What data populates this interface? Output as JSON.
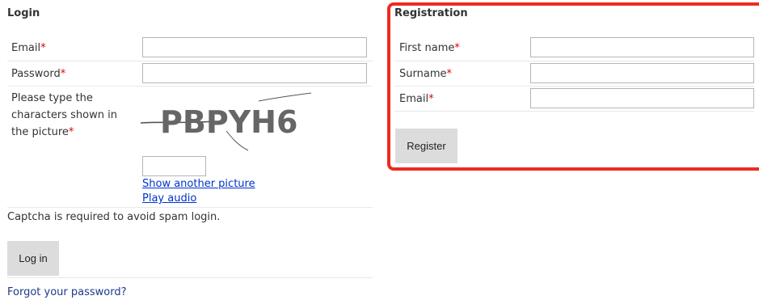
{
  "login": {
    "title": "Login",
    "email_label": "Email",
    "password_label": "Password",
    "captcha_label_line1": "Please type the",
    "captcha_label_line2": "characters shown in",
    "captcha_label_line3": "the picture",
    "required_mark": "*",
    "captcha_text": "PBPYH6",
    "show_another_picture": "Show another picture",
    "play_audio": "Play audio",
    "captcha_note": "Captcha is required to avoid spam login.",
    "login_button": "Log in",
    "forgot_password": "Forgot your password?"
  },
  "registration": {
    "title": "Registration",
    "first_name_label": "First name",
    "surname_label": "Surname",
    "email_label": "Email",
    "register_button": "Register"
  },
  "colors": {
    "required": "#e00000",
    "highlight_border": "#ee2a22",
    "link": "#0033cc"
  }
}
